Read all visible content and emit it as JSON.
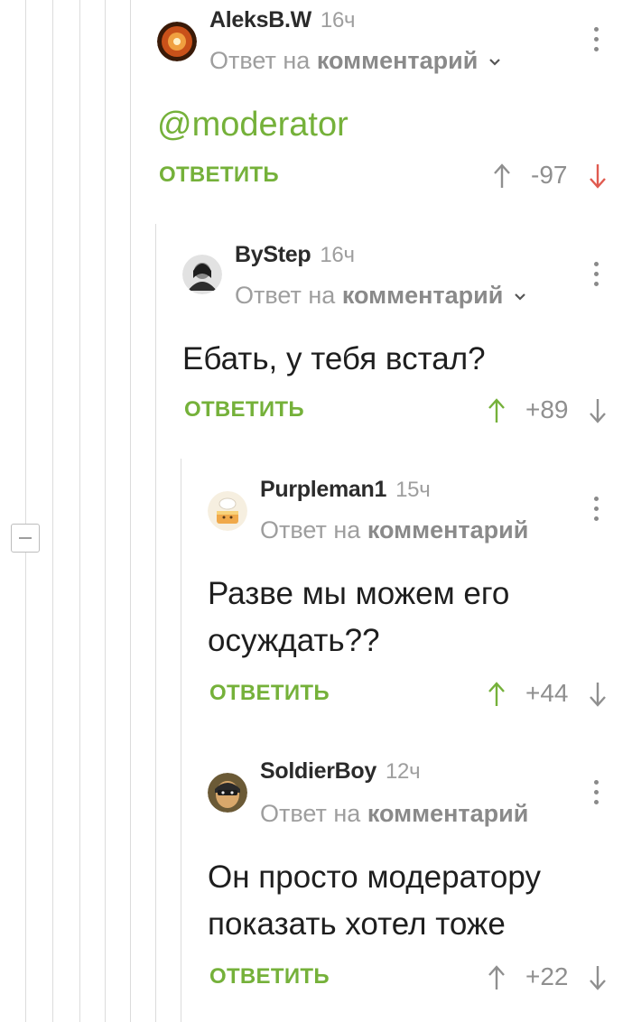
{
  "collapse_symbol": "−",
  "reply_prefix": "Ответ на",
  "reply_target": "комментарий",
  "reply_button": "ОТВЕТИТЬ",
  "colors": {
    "accent_green": "#75b13a",
    "downvote_red": "#e05a4f",
    "muted": "#9e9e9e"
  },
  "comments": [
    {
      "author": "AleksB.W",
      "time": "16ч",
      "text": "@moderator",
      "score": "-97",
      "vote_state": "down",
      "avatar_icon": "orange-orb-avatar"
    },
    {
      "author": "ByStep",
      "time": "16ч",
      "text": "Ебать, у тебя встал?",
      "score": "+89",
      "vote_state": "up",
      "avatar_icon": "person-avatar"
    },
    {
      "author": "Purpleman1",
      "time": "15ч",
      "text_lines": [
        "Разве мы можем его",
        "осуждать??"
      ],
      "score": "+44",
      "vote_state": "up",
      "avatar_icon": "cake-avatar"
    },
    {
      "author": "SoldierBoy",
      "time": "12ч",
      "text_lines": [
        "Он просто модератору",
        "показать хотел тоже"
      ],
      "score": "+22",
      "vote_state": "none",
      "avatar_icon": "masked-face-avatar"
    }
  ]
}
